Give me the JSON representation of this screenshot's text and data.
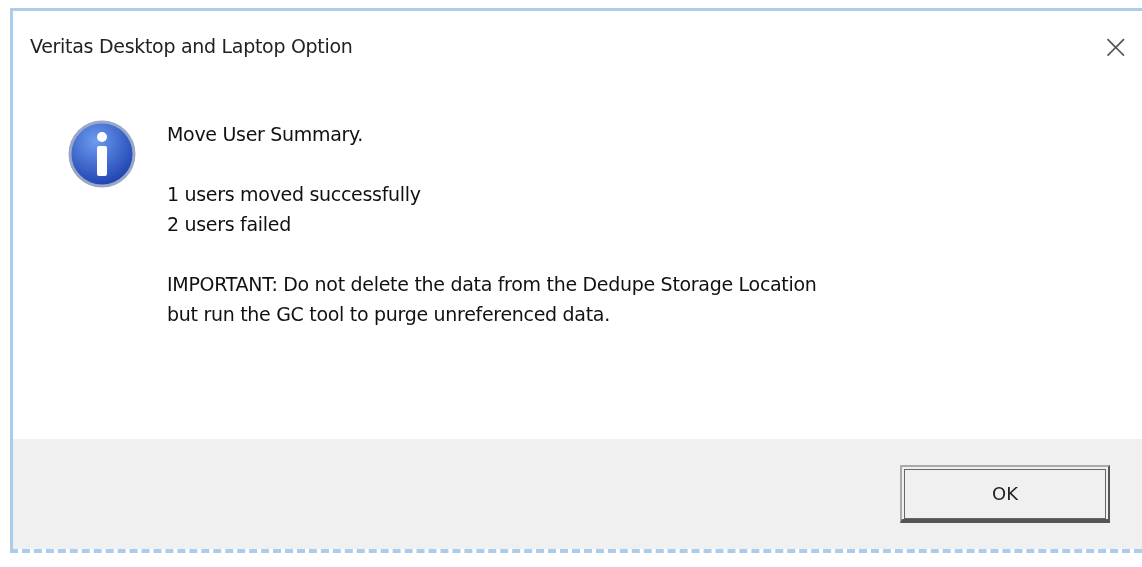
{
  "window": {
    "title": "Veritas Desktop and Laptop Option",
    "close": "×"
  },
  "message": {
    "heading": "Move User Summary.",
    "lines": [
      "1 users moved successfully",
      "2 users failed"
    ],
    "note": [
      "IMPORTANT: Do not delete the data from the Dedupe Storage Location",
      "but run the GC tool to purge unreferenced data."
    ]
  },
  "buttons": [
    {
      "label": "OK",
      "default": true
    }
  ]
}
